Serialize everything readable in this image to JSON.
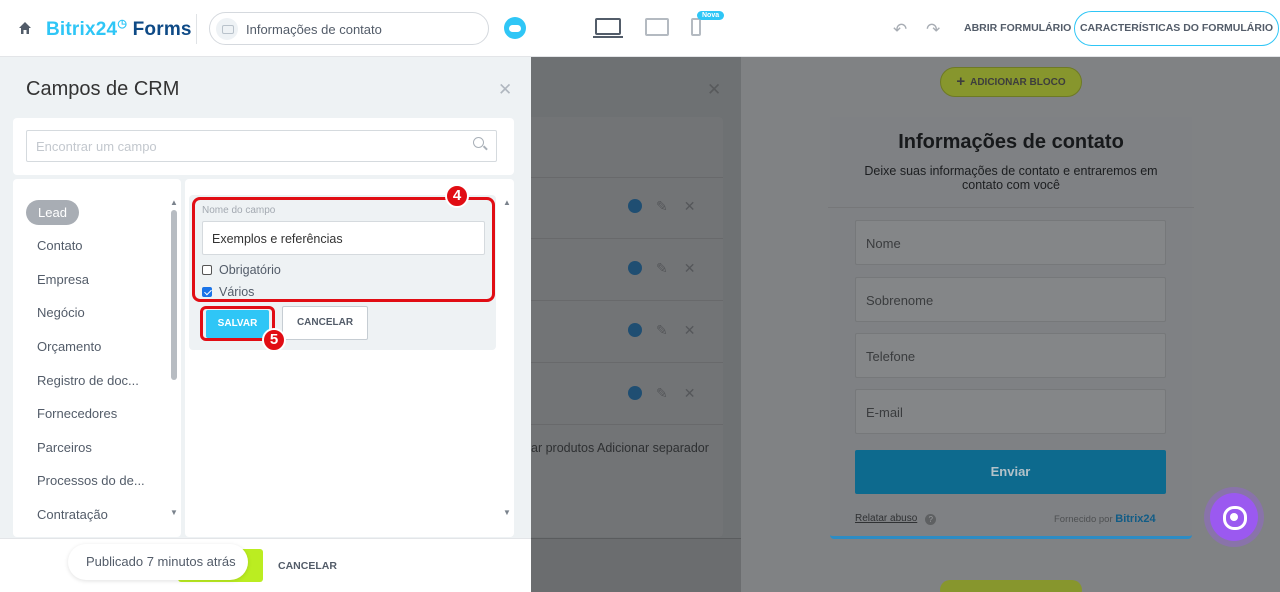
{
  "header": {
    "brand_main": "Bitrix24",
    "brand_clock": "◷",
    "brand_forms": "Forms",
    "form_title": "Informações de contato",
    "nova_badge": "Nova",
    "open_form": "ABRIR FORMULÁRIO",
    "form_features": "CARACTERÍSTICAS DO FORMULÁRIO"
  },
  "crm_panel": {
    "title": "Campos de CRM",
    "search_placeholder": "Encontrar um campo",
    "entities": [
      "Lead",
      "Contato",
      "Empresa",
      "Negócio",
      "Orçamento",
      "Registro de doc...",
      "Fornecedores",
      "Parceiros",
      "Processos do de...",
      "Contratação"
    ],
    "active_entity": "Lead",
    "edit": {
      "field_label": "Nome do campo",
      "field_value": "Exemplos e referências",
      "required_label": "Obrigatório",
      "required_checked": false,
      "multiple_label": "Vários",
      "multiple_checked": true,
      "save": "SALVAR",
      "cancel": "CANCELAR"
    },
    "step_4": "4",
    "step_5": "5"
  },
  "footer": {
    "published": "Publicado 7 minutos atrás",
    "cancel": "CANCELAR"
  },
  "background_panel": {
    "links": "ar produtos  Adicionar separador"
  },
  "form_preview": {
    "add_block": "ADICIONAR BLOCO",
    "heading": "Informações de contato",
    "subtitle": "Deixe suas informações de contato e entraremos em contato com você",
    "fields": [
      "Nome",
      "Sobrenome",
      "Telefone",
      "E-mail"
    ],
    "submit": "Enviar",
    "report": "Relatar abuso",
    "powered_by": "Fornecido por",
    "powered_brand": "Bitrix24"
  },
  "colors": {
    "accent": "#2fc6f6",
    "highlight": "#e10d14",
    "publish_green": "#bbed21"
  }
}
